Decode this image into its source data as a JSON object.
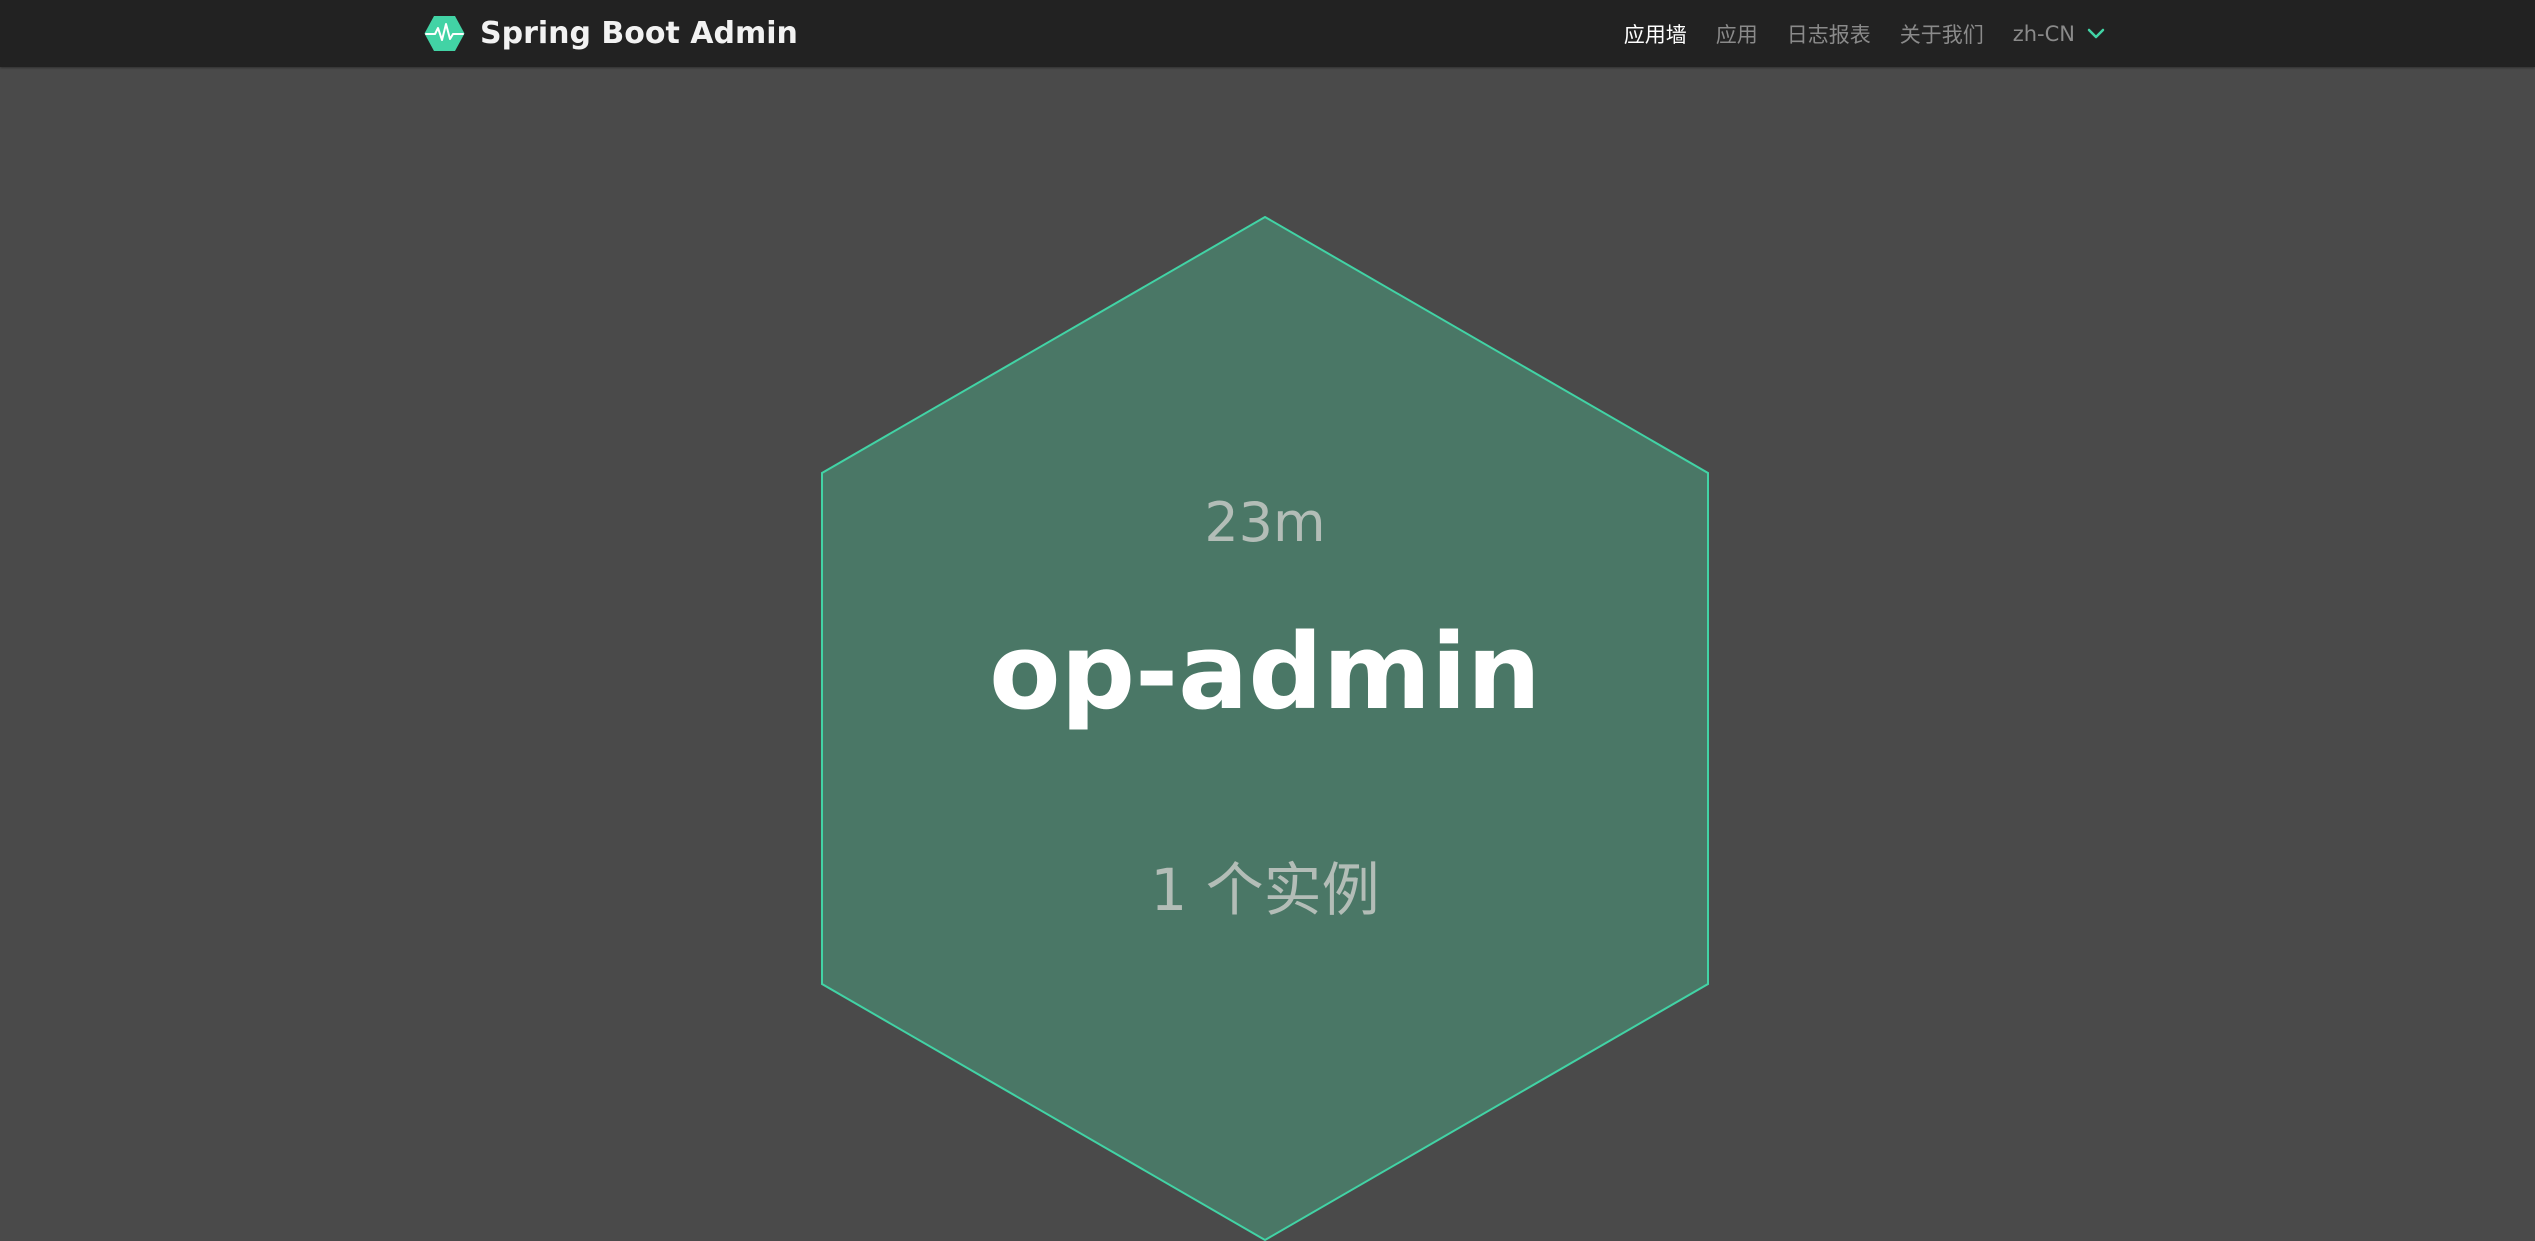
{
  "brand": {
    "title": "Spring Boot Admin",
    "logo_icon": "heartbeat-hexagon-icon",
    "logo_color": "#42d3a5"
  },
  "nav": {
    "items": [
      {
        "label": "应用墙",
        "active": true
      },
      {
        "label": "应用",
        "active": false
      },
      {
        "label": "日志报表",
        "active": false
      },
      {
        "label": "关于我们",
        "active": false
      }
    ],
    "language": {
      "label": "zh-CN",
      "icon": "chevron-down-icon"
    }
  },
  "wall": {
    "applications": [
      {
        "uptime": "23m",
        "name": "op-admin",
        "instances": "1 个实例",
        "status_color": "#42d3a5",
        "fill_color": "#4a7766"
      }
    ]
  },
  "colors": {
    "background": "#4a4a4a",
    "navbar": "#222222",
    "accent": "#42d3a5"
  }
}
